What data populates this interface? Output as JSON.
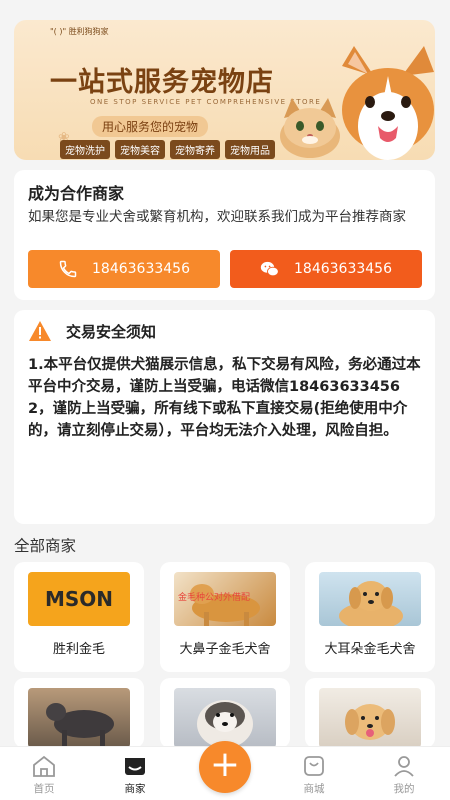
{
  "banner": {
    "brand": "\"( )\" 胜利狗狗家",
    "title": "一站式服务宠物店",
    "subtitle_en": "ONE STOP SERVICE PET COMPREHENSIVE STORE",
    "slogan": "用心服务您的宠物",
    "tags": [
      "宠物洗护",
      "宠物美容",
      "宠物寄养",
      "宠物用品"
    ]
  },
  "partner": {
    "title": "成为合作商家",
    "description": "如果您是专业犬舍或繁育机构，欢迎联系我们成为平台推荐商家",
    "phone_button": "18463633456",
    "wechat_button": "18463633456"
  },
  "notice": {
    "title": "交易安全须知",
    "line1": "1.本平台仅提供犬猫展示信息，私下交易有风险，务必通过本平台中介交易，谨防上当受骗，电话微信18463633456",
    "line2": "2，谨防上当受骗，所有线下或私下直接交易(拒绝使用中介的，请立刻停止交易），平台均无法介入处理，风险自担。"
  },
  "section": {
    "title": "全部商家"
  },
  "merchants": [
    {
      "name": "胜利金毛",
      "logo_text": "MSON"
    },
    {
      "name": "大鼻子金毛犬舍",
      "image_caption": "金毛种公对外借配"
    },
    {
      "name": "大耳朵金毛犬舍"
    },
    {
      "name": ""
    },
    {
      "name": ""
    },
    {
      "name": ""
    }
  ],
  "tabbar": {
    "items": [
      {
        "label": "首页",
        "icon": "home-icon"
      },
      {
        "label": "商家",
        "icon": "store-icon"
      },
      {
        "label": "",
        "icon": "plus-icon"
      },
      {
        "label": "商城",
        "icon": "bag-icon"
      },
      {
        "label": "我的",
        "icon": "user-icon"
      }
    ]
  },
  "colors": {
    "accent": "#f7892b",
    "accent_dark": "#f25c1c",
    "warning": "#f7892b"
  }
}
